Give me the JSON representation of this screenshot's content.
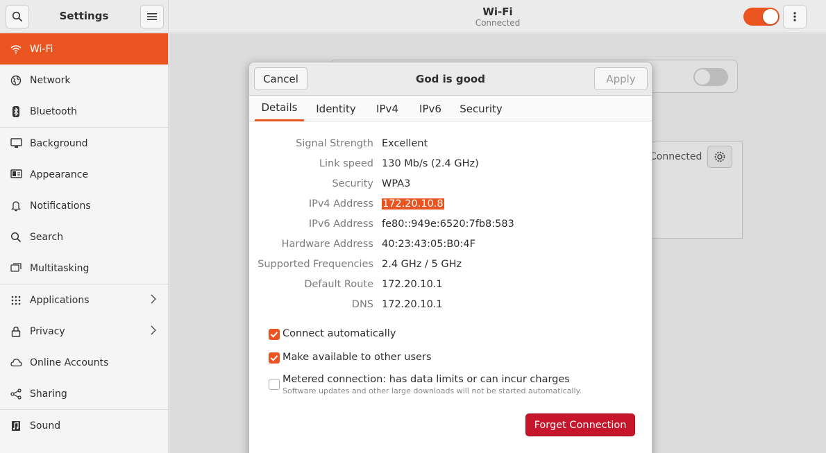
{
  "sidebar_header": {
    "title": "Settings"
  },
  "main_header": {
    "title": "Wi-Fi",
    "subtitle": "Connected"
  },
  "sidebar": {
    "items": [
      {
        "label": "Wi-Fi",
        "icon": "wifi-icon"
      },
      {
        "label": "Network",
        "icon": "globe-icon"
      },
      {
        "label": "Bluetooth",
        "icon": "bluetooth-icon"
      },
      {
        "label": "Background",
        "icon": "monitor-icon"
      },
      {
        "label": "Appearance",
        "icon": "appearance-icon"
      },
      {
        "label": "Notifications",
        "icon": "bell-icon"
      },
      {
        "label": "Search",
        "icon": "search-icon"
      },
      {
        "label": "Multitasking",
        "icon": "multitasking-icon"
      },
      {
        "label": "Applications",
        "icon": "grid-icon"
      },
      {
        "label": "Privacy",
        "icon": "lock-icon"
      },
      {
        "label": "Online Accounts",
        "icon": "cloud-icon"
      },
      {
        "label": "Sharing",
        "icon": "share-icon"
      },
      {
        "label": "Sound",
        "icon": "music-icon"
      }
    ]
  },
  "background": {
    "connected_text": "Connected"
  },
  "dialog": {
    "cancel_label": "Cancel",
    "title": "God is good",
    "apply_label": "Apply",
    "tabs": [
      "Details",
      "Identity",
      "IPv4",
      "IPv6",
      "Security"
    ],
    "details": [
      {
        "label": "Signal Strength",
        "value": "Excellent"
      },
      {
        "label": "Link speed",
        "value": "130 Mb/s (2.4 GHz)"
      },
      {
        "label": "Security",
        "value": "WPA3"
      },
      {
        "label": "IPv4 Address",
        "value": "172.20.10.8"
      },
      {
        "label": "IPv6 Address",
        "value": "fe80::949e:6520:7fb8:583"
      },
      {
        "label": "Hardware Address",
        "value": "40:23:43:05:B0:4F"
      },
      {
        "label": "Supported Frequencies",
        "value": "2.4 GHz / 5 GHz"
      },
      {
        "label": "Default Route",
        "value": "172.20.10.1"
      },
      {
        "label": "DNS",
        "value": "172.20.10.1"
      }
    ],
    "connect_auto_label": "Connect automatically",
    "available_users_label": "Make available to other users",
    "metered_label": "Metered connection: has data limits or can incur charges",
    "metered_sub": "Software updates and other large downloads will not be started automatically.",
    "forget_label": "Forget Connection"
  },
  "colors": {
    "accent": "#e95420",
    "destructive": "#c7162b"
  }
}
